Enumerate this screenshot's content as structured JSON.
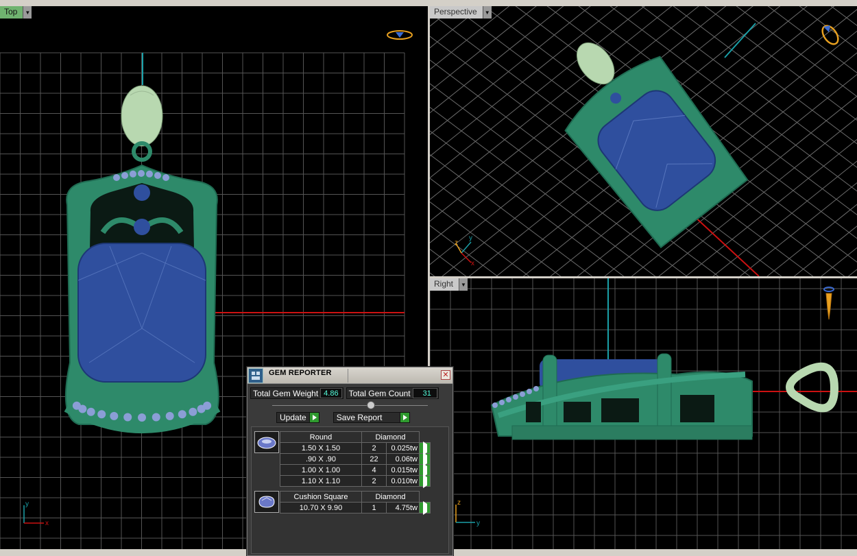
{
  "viewports": {
    "top": {
      "label": "Top"
    },
    "perspective": {
      "label": "Perspective"
    },
    "right": {
      "label": "Right"
    }
  },
  "axes": {
    "x": "x",
    "y": "y",
    "z": "z"
  },
  "colors": {
    "background": "#000000",
    "grid": "#5a5a5a",
    "axis_x": "#cc1111",
    "axis_y": "#1aa0a8",
    "metal": "#2e8a6a",
    "gem": "#2f4f9e",
    "bail": "#b8d8b0"
  },
  "gem_reporter": {
    "title": "GEM REPORTER",
    "total_weight_label": "Total Gem Weight",
    "total_weight_value": "4.86",
    "total_count_label": "Total Gem Count",
    "total_count_value": "31",
    "update_label": "Update",
    "save_label": "Save Report",
    "groups": [
      {
        "shape": "Round",
        "material": "Diamond",
        "rows": [
          {
            "size": "1.50 X 1.50",
            "count": "2",
            "weight": "0.025tw"
          },
          {
            "size": ".90 X .90",
            "count": "22",
            "weight": "0.06tw"
          },
          {
            "size": "1.00 X 1.00",
            "count": "4",
            "weight": "0.015tw"
          },
          {
            "size": "1.10 X 1.10",
            "count": "2",
            "weight": "0.010tw"
          }
        ]
      },
      {
        "shape": "Cushion Square",
        "material": "Diamond",
        "rows": [
          {
            "size": "10.70 X 9.90",
            "count": "1",
            "weight": "4.75tw"
          }
        ]
      }
    ]
  }
}
